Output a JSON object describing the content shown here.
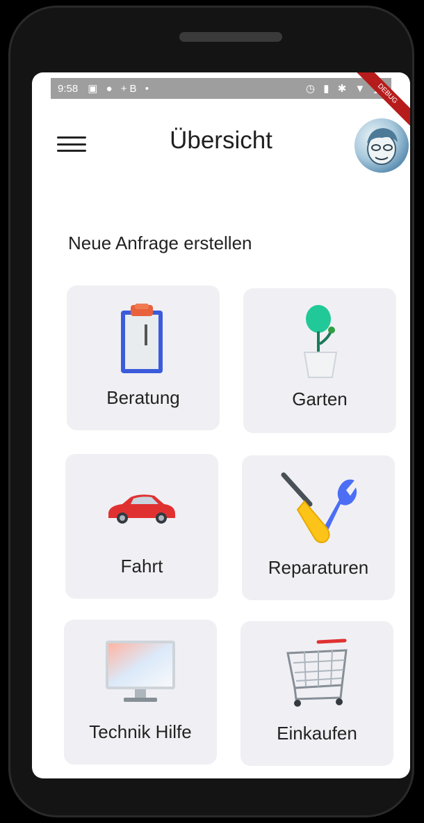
{
  "status_bar": {
    "time": "9:58",
    "left_icons": "▣ ● +B •",
    "right_icons": "◷ ▮ ✱ ▼ ◢",
    "debug_label": "DEBUG"
  },
  "app_bar": {
    "title": "Übersicht",
    "menu_icon": "hamburger-menu-icon",
    "avatar": "user-avatar"
  },
  "section": {
    "heading": "Neue Anfrage erstellen"
  },
  "categories": [
    {
      "label": "Beratung",
      "icon": "clipboard-icon"
    },
    {
      "label": "Garten",
      "icon": "plant-pot-icon"
    },
    {
      "label": "Fahrt",
      "icon": "car-icon"
    },
    {
      "label": "Reparaturen",
      "icon": "tools-icon"
    },
    {
      "label": "Technik Hilfe",
      "icon": "monitor-icon"
    },
    {
      "label": "Einkaufen",
      "icon": "shopping-cart-icon"
    }
  ],
  "colors": {
    "tile_background": "#f0f0f4",
    "screen_background": "#ffffff",
    "status_bar": "#9e9e9e",
    "device_frame": "#141414"
  }
}
